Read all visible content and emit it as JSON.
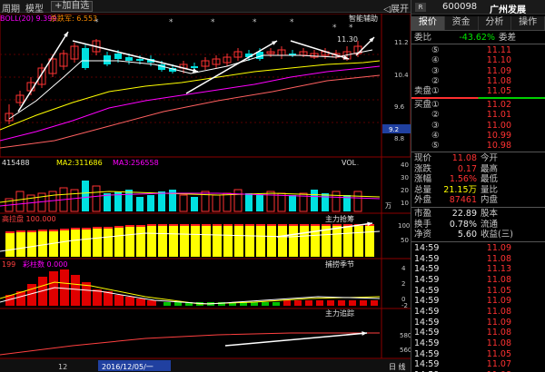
{
  "toolbar": {
    "items": [
      "周期",
      "模型",
      "加自选"
    ],
    "right_label": "展开"
  },
  "main_chart": {
    "indicator_label": "BOLL(20) 9.399",
    "indicator2_label": "杀跌军: 6.553",
    "smart_label": "智能辅助",
    "top_label": "11.30",
    "y_ticks": [
      "11.2",
      "10.4",
      "9.6",
      "8.8"
    ],
    "current_price_tag": "9.2",
    "marker_symbol": "*"
  },
  "volume_panel": {
    "vol_label": "415488",
    "ma2_label": "MA2:311686",
    "ma3_label": "MA3:256558",
    "title": "VOL",
    "y_ticks": [
      "40",
      "30",
      "20",
      "10"
    ],
    "unit": "万"
  },
  "panel3": {
    "label": "高拉盘 100.000",
    "right_label": "主力抢筹",
    "y_ticks": [
      "100",
      "50"
    ]
  },
  "panel4": {
    "label1": "199",
    "label2": "彩柱数 0.000",
    "right_label": "捕捞季节",
    "y_ticks": [
      "4",
      "2",
      "0",
      "-2"
    ]
  },
  "panel5": {
    "right_label": "主力追踪",
    "y_ticks": [
      "580",
      "560"
    ]
  },
  "time_axis": {
    "label_left": "12",
    "date_label": "2016/12/05/一",
    "right_label": "日 线"
  },
  "colors": {
    "up": "#ff3232",
    "down": "#00e0e0",
    "yellow": "#ffff00",
    "magenta": "#ff00ff",
    "accent_red": "#ff3030"
  },
  "right_panel": {
    "badge": "R",
    "code": "600098",
    "name": "广州发展",
    "tabs": [
      "报价",
      "资金",
      "分析",
      "操作"
    ],
    "commission": {
      "label": "委比",
      "value": "-43.62%",
      "label2": "委差"
    },
    "sell_orders": [
      {
        "level": "⑤",
        "price": "11.11"
      },
      {
        "level": "④",
        "price": "11.10"
      },
      {
        "level": "③",
        "price": "11.09"
      },
      {
        "level": "②",
        "price": "11.08"
      },
      {
        "label": "卖盘",
        "level": "①",
        "price": "11.05"
      }
    ],
    "buy_orders": [
      {
        "label": "买盘",
        "level": "①",
        "price": "11.02"
      },
      {
        "level": "②",
        "price": "11.01"
      },
      {
        "level": "③",
        "price": "11.00"
      },
      {
        "level": "④",
        "price": "10.99"
      },
      {
        "level": "⑤",
        "price": "10.98"
      }
    ],
    "quotes": [
      {
        "l1": "现价",
        "v1": "11.08",
        "c1": "red",
        "l2": "今开",
        "v2": "",
        "c2": "white"
      },
      {
        "l1": "涨跌",
        "v1": "0.17",
        "c1": "red",
        "l2": "最高",
        "v2": "",
        "c2": "white"
      },
      {
        "l1": "涨幅",
        "v1": "1.56%",
        "c1": "red",
        "l2": "最低",
        "v2": "",
        "c2": "white"
      },
      {
        "l1": "总量",
        "v1": "21.15万",
        "c1": "yellow",
        "l2": "量比",
        "v2": "",
        "c2": "white"
      },
      {
        "l1": "外盘",
        "v1": "87461",
        "c1": "red",
        "l2": "内盘",
        "v2": "",
        "c2": "white"
      }
    ],
    "quotes2": [
      {
        "l1": "市盈",
        "v1": "22.89",
        "l2": "股本"
      },
      {
        "l1": "换手",
        "v1": "0.78%",
        "l2": "流通"
      },
      {
        "l1": "净资",
        "v1": "5.60",
        "l2": "收益(三)"
      }
    ],
    "ticks": [
      {
        "time": "14:59",
        "price": "11.09"
      },
      {
        "time": "14:59",
        "price": "11.08"
      },
      {
        "time": "14:59",
        "price": "11.13"
      },
      {
        "time": "14:59",
        "price": "11.08"
      },
      {
        "time": "14:59",
        "price": "11.05"
      },
      {
        "time": "14:59",
        "price": "11.09"
      },
      {
        "time": "14:59",
        "price": "11.08"
      },
      {
        "time": "14:59",
        "price": "11.09"
      },
      {
        "time": "14:59",
        "price": "11.08"
      },
      {
        "time": "14:59",
        "price": "11.08"
      },
      {
        "time": "14:59",
        "price": "11.05"
      },
      {
        "time": "14:59",
        "price": "11.07"
      },
      {
        "time": "14:59",
        "price": "11.08"
      }
    ]
  }
}
